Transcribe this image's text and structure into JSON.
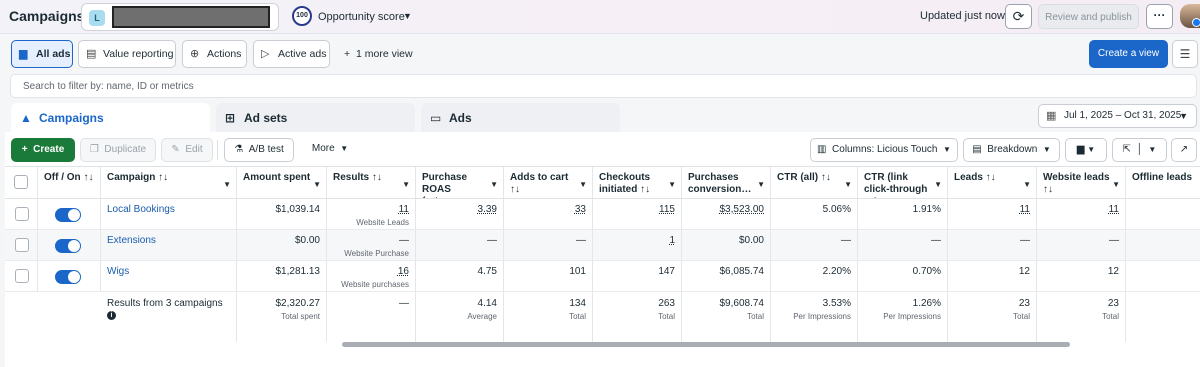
{
  "topbar": {
    "title": "Campaigns",
    "account_initial": "L",
    "score_value": "100",
    "score_label": "Opportunity score",
    "updated": "Updated just now",
    "publish_label": "Review and publish",
    "more_label": "···"
  },
  "viewbar": {
    "buttons": [
      {
        "label": "All ads",
        "icon": "folder-icon"
      },
      {
        "label": "Value reporting",
        "icon": "report-icon"
      },
      {
        "label": "Actions",
        "icon": "actions-icon"
      },
      {
        "label": "Active ads",
        "icon": "send-icon"
      }
    ],
    "more_views": "1 more view",
    "create_view": "Create a view"
  },
  "search": {
    "placeholder": "Search to filter by: name, ID or metrics"
  },
  "tabs": [
    {
      "label": "Campaigns",
      "active": true
    },
    {
      "label": "Ad sets",
      "active": false
    },
    {
      "label": "Ads",
      "active": false
    }
  ],
  "date_range": "Jul 1, 2025 – Oct 31, 2025",
  "toolbar": {
    "create": "Create",
    "duplicate": "Duplicate",
    "edit": "Edit",
    "ab_test": "A/B test",
    "more": "More",
    "columns": "Columns: Licious Touch",
    "breakdown": "Breakdown"
  },
  "table": {
    "headers": [
      "Off / On ↑↓",
      "Campaign ↑↓",
      "Amount spent",
      "Results ↑↓",
      "Purchase ROAS (retur…",
      "Adds to cart ↑↓",
      "Checkouts initiated ↑↓",
      "Purchases conversion…",
      "CTR (all) ↑↓",
      "CTR (link click-through rate…",
      "Leads ↑↓",
      "Website leads ↑↓",
      "Offline leads"
    ],
    "rows": [
      {
        "campaign": "Local Bookings",
        "amount_spent": "$1,039.14",
        "results": "11",
        "results_sub": "Website Leads",
        "roas": "3.39",
        "adds_to_cart": "33",
        "checkouts": "115",
        "purchases_value": "$3,523.00",
        "ctr_all": "5.06%",
        "ctr_link": "1.91%",
        "leads": "11",
        "website_leads": "11",
        "offline_leads": ""
      },
      {
        "campaign": "Extensions",
        "amount_spent": "$0.00",
        "results": "—",
        "results_sub": "Website Purchase",
        "roas": "—",
        "adds_to_cart": "—",
        "checkouts": "1",
        "purchases_value": "$0.00",
        "ctr_all": "—",
        "ctr_link": "—",
        "leads": "—",
        "website_leads": "—",
        "offline_leads": ""
      },
      {
        "campaign": "Wigs",
        "amount_spent": "$1,281.13",
        "results": "16",
        "results_sub": "Website purchases",
        "roas": "4.75",
        "adds_to_cart": "101",
        "checkouts": "147",
        "purchases_value": "$6,085.74",
        "ctr_all": "2.20%",
        "ctr_link": "0.70%",
        "leads": "12",
        "website_leads": "12",
        "offline_leads": ""
      }
    ],
    "totals": {
      "label": "Results from 3 campaigns",
      "amount_spent": "$2,320.27",
      "amount_spent_sub": "Total spent",
      "results": "—",
      "roas": "4.14",
      "roas_sub": "Average",
      "adds_to_cart": "134",
      "adds_to_cart_sub": "Total",
      "checkouts": "263",
      "checkouts_sub": "Total",
      "purchases_value": "$9,608.74",
      "purchases_value_sub": "Total",
      "ctr_all": "3.53%",
      "ctr_all_sub": "Per Impressions",
      "ctr_link": "1.26%",
      "ctr_link_sub": "Per Impressions",
      "leads": "23",
      "leads_sub": "Total",
      "website_leads": "23",
      "website_leads_sub": "Total"
    }
  },
  "colors": {
    "accent": "#1a66c9",
    "create_green": "#1a7a3a",
    "link": "#1a5cad"
  }
}
